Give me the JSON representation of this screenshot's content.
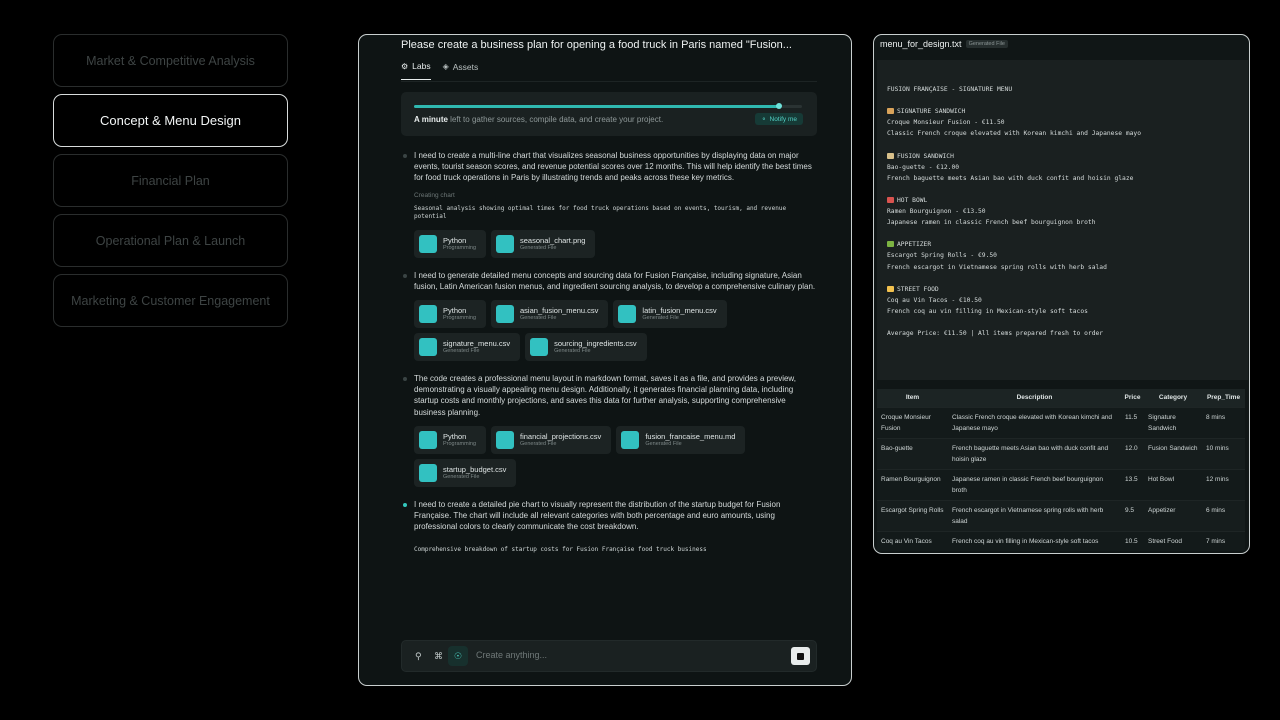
{
  "steps": [
    {
      "label": "Market & Competitive Analysis",
      "active": false
    },
    {
      "label": "Concept & Menu Design",
      "active": true
    },
    {
      "label": "Financial Plan",
      "active": false
    },
    {
      "label": "Operational Plan & Launch",
      "active": false
    },
    {
      "label": "Marketing & Customer Engagement",
      "active": false
    }
  ],
  "center": {
    "title": "Please create a business plan for opening a food truck in Paris named \"Fusion...",
    "tabs": [
      {
        "label": "Labs",
        "icon": "flask-icon",
        "active": true
      },
      {
        "label": "Assets",
        "icon": "layers-icon",
        "active": false
      }
    ],
    "progress": {
      "value": 0.94,
      "time_strong": "A minute",
      "time_rest": " left to gather sources, compile data, and create your project.",
      "notify_label": "Notify me"
    },
    "messages": [
      {
        "text": "I need to create a multi-line chart that visualizes seasonal business opportunities by displaying data on major events, tourist season scores, and revenue potential scores over 12 months. This will help identify the best times for food truck operations in Paris by illustrating trends and peaks across these key metrics.",
        "status": "Creating chart",
        "mono": "Seasonal analysis showing optimal times for food truck operations based on events, tourism, and revenue potential",
        "chips": [
          {
            "name": "Python",
            "type": "Programming"
          },
          {
            "name": "seasonal_chart.png",
            "type": "Generated File"
          }
        ]
      },
      {
        "text": "I need to generate detailed menu concepts and sourcing data for Fusion Française, including signature, Asian fusion, Latin American fusion menus, and ingredient sourcing analysis, to develop a comprehensive culinary plan.",
        "chips": [
          {
            "name": "Python",
            "type": "Programming"
          },
          {
            "name": "asian_fusion_menu.csv",
            "type": "Generated File"
          },
          {
            "name": "latin_fusion_menu.csv",
            "type": "Generated File"
          },
          {
            "name": "signature_menu.csv",
            "type": "Generated File"
          },
          {
            "name": "sourcing_ingredients.csv",
            "type": "Generated File"
          }
        ]
      },
      {
        "text": "The code creates a professional menu layout in markdown format, saves it as a file, and provides a preview, demonstrating a visually appealing menu design. Additionally, it generates financial planning data, including startup costs and monthly projections, and saves this data for further analysis, supporting comprehensive business planning.",
        "chips": [
          {
            "name": "Python",
            "type": "Programming"
          },
          {
            "name": "financial_projections.csv",
            "type": "Generated File"
          },
          {
            "name": "fusion_francaise_menu.md",
            "type": "Generated File"
          },
          {
            "name": "startup_budget.csv",
            "type": "Generated File"
          }
        ]
      },
      {
        "text": "I need to create a detailed pie chart to visually represent the distribution of the startup budget for Fusion Française. The chart will include all relevant categories with both percentage and euro amounts, using professional colors to clearly communicate the cost breakdown.",
        "mono": "Comprehensive breakdown of startup costs for Fusion Française food truck business",
        "live": true
      }
    ],
    "input": {
      "placeholder": "Create anything..."
    }
  },
  "right": {
    "file_name": "menu_for_design.txt",
    "badge": "Generated File",
    "code_lines": [
      {
        "text": "FUSION FRANÇAISE - SIGNATURE MENU"
      },
      {
        "text": ""
      },
      {
        "text": "SIGNATURE SANDWICH",
        "emoji": "#d9a35a"
      },
      {
        "text": "Croque Monsieur Fusion - €11.50"
      },
      {
        "text": "Classic French croque elevated with Korean kimchi and Japanese mayo"
      },
      {
        "text": ""
      },
      {
        "text": "FUSION SANDWICH",
        "emoji": "#d8c08a"
      },
      {
        "text": "Bao-guette - €12.00"
      },
      {
        "text": "French baguette meets Asian bao with duck confit and hoisin glaze"
      },
      {
        "text": ""
      },
      {
        "text": "HOT BOWL",
        "emoji": "#d9534f"
      },
      {
        "text": "Ramen Bourguignon - €13.50"
      },
      {
        "text": "Japanese ramen in classic French beef bourguignon broth"
      },
      {
        "text": ""
      },
      {
        "text": "APPETIZER",
        "emoji": "#7cb342"
      },
      {
        "text": "Escargot Spring Rolls - €9.50"
      },
      {
        "text": "French escargot in Vietnamese spring rolls with herb salad"
      },
      {
        "text": ""
      },
      {
        "text": "STREET FOOD",
        "emoji": "#f2c14e"
      },
      {
        "text": "Coq au Vin Tacos - €10.50"
      },
      {
        "text": "French coq au vin filling in Mexican-style soft tacos"
      },
      {
        "text": ""
      },
      {
        "text": "Average Price: €11.50 | All items prepared fresh to order"
      }
    ],
    "table": {
      "headers": [
        "Item",
        "Description",
        "Price",
        "Category",
        "Prep_Time"
      ],
      "rows": [
        [
          "Croque Monsieur Fusion",
          "Classic French croque elevated with Korean kimchi and Japanese mayo",
          "11.5",
          "Signature Sandwich",
          "8 mins"
        ],
        [
          "Bao-guette",
          "French baguette meets Asian bao with duck confit and hoisin glaze",
          "12.0",
          "Fusion Sandwich",
          "10 mins"
        ],
        [
          "Ramen Bourguignon",
          "Japanese ramen in classic French beef bourguignon broth",
          "13.5",
          "Hot Bowl",
          "12 mins"
        ],
        [
          "Escargot Spring Rolls",
          "French escargot in Vietnamese spring rolls with herb salad",
          "9.5",
          "Appetizer",
          "6 mins"
        ],
        [
          "Coq au Vin Tacos",
          "French coq au vin filling in Mexican-style soft tacos",
          "10.5",
          "Street Food",
          "7 mins"
        ]
      ]
    }
  }
}
